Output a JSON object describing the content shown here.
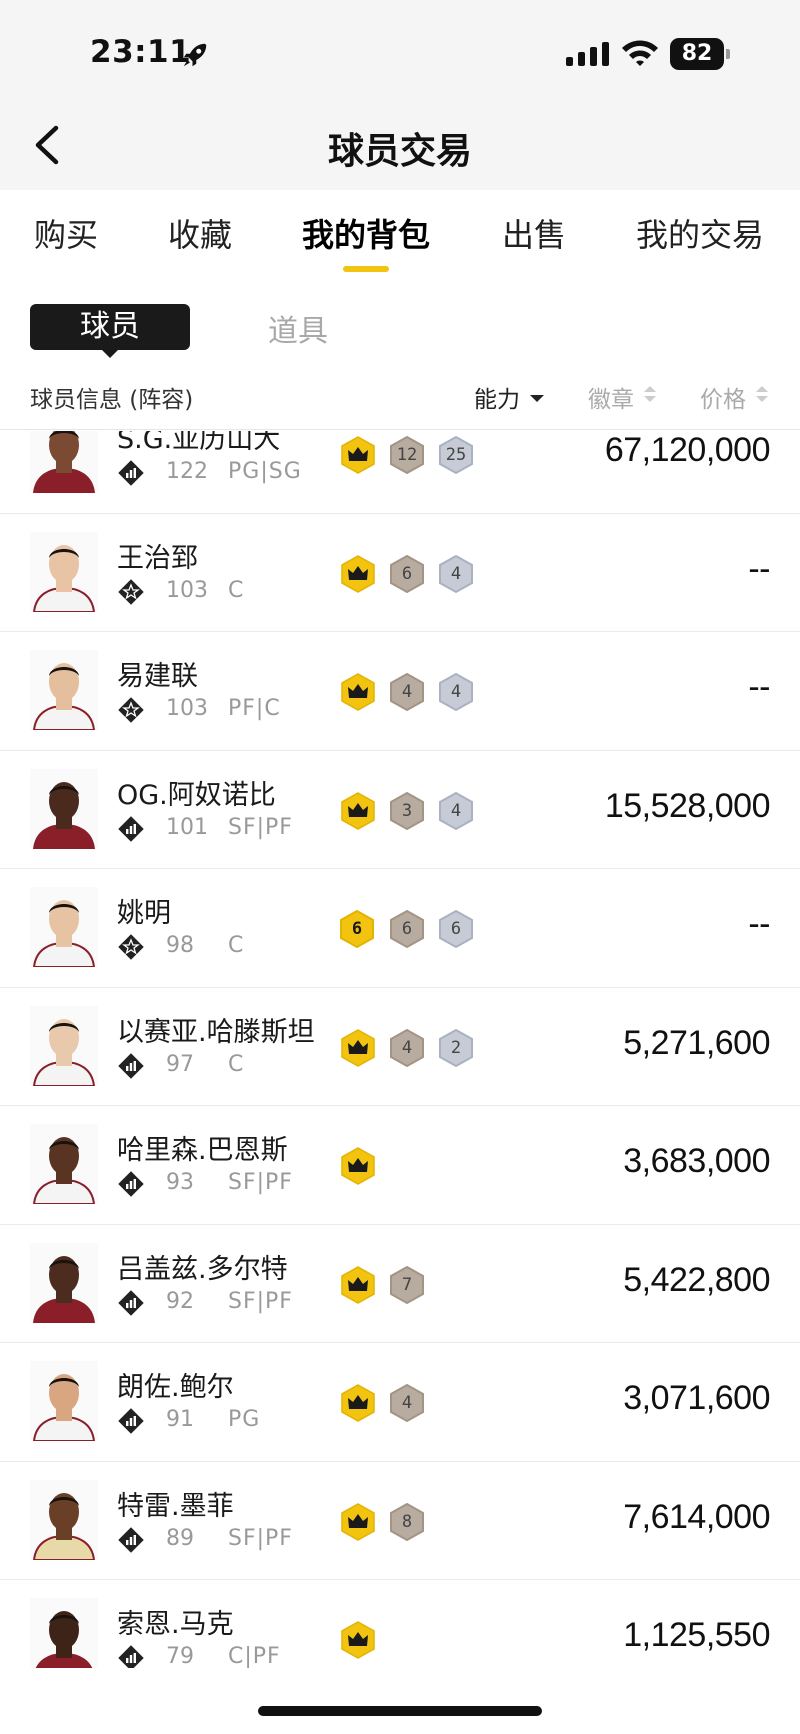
{
  "status_bar": {
    "time": "23:11",
    "battery": "82"
  },
  "header": {
    "title": "球员交易"
  },
  "tabs": [
    {
      "label": "购买"
    },
    {
      "label": "收藏"
    },
    {
      "label": "我的背包"
    },
    {
      "label": "出售"
    },
    {
      "label": "我的交易"
    }
  ],
  "segments": {
    "players": "球员",
    "items": "道具"
  },
  "columns": {
    "info": "球员信息 (阵容)",
    "ability": "能力",
    "badge": "徽章",
    "price": "价格"
  },
  "colors": {
    "accent": "#f2c40f",
    "badge_gold": "#f2c40f",
    "badge_bronze": "#b8aba0",
    "badge_silver": "#c6cbd6"
  },
  "players": [
    {
      "name": "S.G.亚历山大",
      "rating": "122",
      "pos": "PG|SG",
      "card": "card-icon",
      "crown": "crown",
      "b1": "12",
      "b2": "25",
      "price": "67,120,000"
    },
    {
      "name": "王治郅",
      "rating": "103",
      "pos": "C",
      "card": "star-card-icon",
      "crown": "crown",
      "b1": "6",
      "b2": "4",
      "price": "--"
    },
    {
      "name": "易建联",
      "rating": "103",
      "pos": "PF|C",
      "card": "star-card-icon",
      "crown": "crown",
      "b1": "4",
      "b2": "4",
      "price": "--"
    },
    {
      "name": "OG.阿奴诺比",
      "rating": "101",
      "pos": "SF|PF",
      "card": "card-icon",
      "crown": "crown",
      "b1": "3",
      "b2": "4",
      "price": "15,528,000"
    },
    {
      "name": "姚明",
      "rating": "98",
      "pos": "C",
      "card": "star-card-icon",
      "crown": "6",
      "b1": "6",
      "b2": "6",
      "price": "--"
    },
    {
      "name": "以赛亚.哈滕斯坦",
      "rating": "97",
      "pos": "C",
      "card": "card-icon",
      "crown": "crown",
      "b1": "4",
      "b2": "2",
      "price": "5,271,600"
    },
    {
      "name": "哈里森.巴恩斯",
      "rating": "93",
      "pos": "SF|PF",
      "card": "card-icon",
      "crown": "crown",
      "b1": "",
      "b2": "",
      "price": "3,683,000"
    },
    {
      "name": "吕盖兹.多尔特",
      "rating": "92",
      "pos": "SF|PF",
      "card": "card-icon",
      "crown": "crown",
      "b1": "7",
      "b2": "",
      "price": "5,422,800"
    },
    {
      "name": "朗佐.鲍尔",
      "rating": "91",
      "pos": "PG",
      "card": "card-icon",
      "crown": "crown",
      "b1": "4",
      "b2": "",
      "price": "3,071,600"
    },
    {
      "name": "特雷.墨菲",
      "rating": "89",
      "pos": "SF|PF",
      "card": "card-icon",
      "crown": "crown",
      "b1": "8",
      "b2": "",
      "price": "7,614,000"
    },
    {
      "name": "索恩.马克",
      "rating": "79",
      "pos": "C|PF",
      "card": "card-icon",
      "crown": "crown",
      "b1": "",
      "b2": "",
      "price": "1,125,550"
    }
  ]
}
